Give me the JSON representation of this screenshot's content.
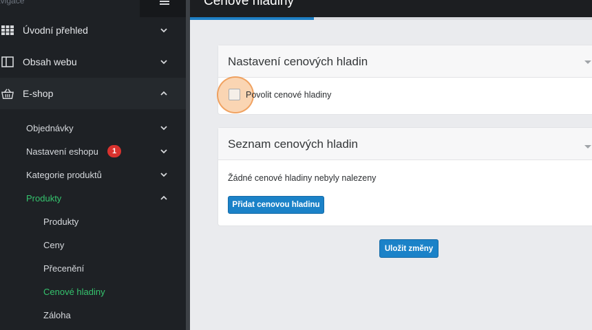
{
  "sidebar": {
    "caption": "avigace",
    "items": [
      {
        "label": "Úvodní přehled",
        "icon": "grid-icon"
      },
      {
        "label": "Obsah webu",
        "icon": "layout-icon"
      },
      {
        "label": "E-shop",
        "icon": "basket-icon"
      }
    ],
    "eshop_sub": [
      {
        "label": "Objednávky"
      },
      {
        "label": "Nastavení eshopu",
        "badge": "1"
      },
      {
        "label": "Kategorie produktů"
      },
      {
        "label": "Produkty"
      }
    ],
    "produkty_sub": [
      {
        "label": "Produkty"
      },
      {
        "label": "Ceny"
      },
      {
        "label": "Přecenění"
      },
      {
        "label": "Cenové hladiny"
      },
      {
        "label": "Záloha"
      }
    ]
  },
  "header": {
    "title": "Cenové hladiny"
  },
  "panels": {
    "settings": {
      "title": "Nastavení cenových hladin",
      "checkbox_label": "Povolit cenové hladiny",
      "checkbox_checked": false
    },
    "list": {
      "title": "Seznam cenových hladin",
      "empty_text": "Žádné cenové hladiny nebyly nalezeny",
      "add_button": "Přidat cenovou hladinu"
    }
  },
  "save_button": "Uložit změny",
  "colors": {
    "sidebar_bg": "#1e2125",
    "active_green": "#35c46e",
    "primary_blue": "#1b82c8",
    "badge_red": "#d9322e"
  }
}
